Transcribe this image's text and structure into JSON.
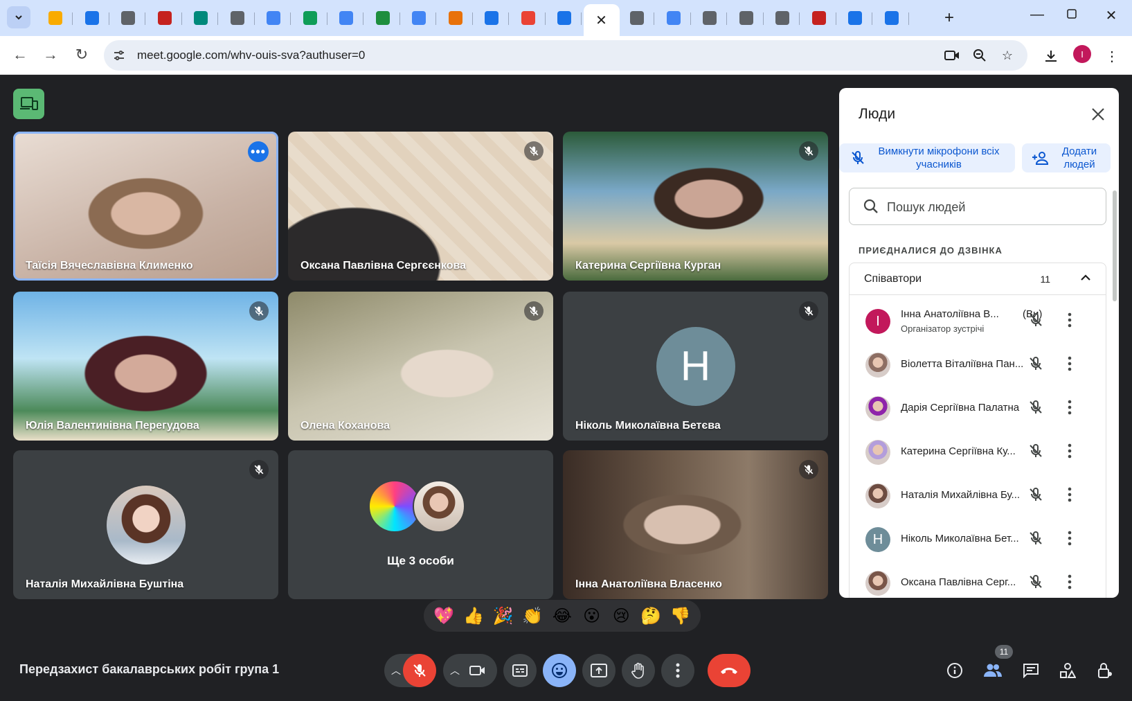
{
  "browser": {
    "tabs": [
      {
        "icon": "chevron-down-icon"
      },
      {
        "icon": "bookmark-ext-icon",
        "color": "#f9ab00"
      },
      {
        "icon": "history-icon",
        "color": "#1a73e8"
      },
      {
        "icon": "chrome-icon",
        "color": "#5f6368"
      },
      {
        "icon": "sound-icon",
        "color": "#c5221f"
      },
      {
        "icon": "puzzle-icon",
        "color": "#00897b"
      },
      {
        "icon": "globe-icon",
        "color": "#5f6368"
      },
      {
        "icon": "docs-icon",
        "color": "#4285f4"
      },
      {
        "icon": "drive-icon",
        "color": "#0f9d58"
      },
      {
        "icon": "docs-icon",
        "color": "#4285f4"
      },
      {
        "icon": "chart-icon",
        "color": "#1e8e3e"
      },
      {
        "icon": "google-icon",
        "color": "#4285f4"
      },
      {
        "icon": "analytics-icon",
        "color": "#e8710a"
      },
      {
        "icon": "analytics-icon",
        "color": "#1a73e8"
      },
      {
        "icon": "gmail-icon",
        "color": "#ea4335"
      },
      {
        "icon": "calendar-icon",
        "color": "#1a73e8"
      },
      {
        "icon": "close-icon",
        "active": true
      },
      {
        "icon": "globe-icon",
        "color": "#5f6368"
      },
      {
        "icon": "google-icon",
        "color": "#4285f4"
      },
      {
        "icon": "globe-icon",
        "color": "#5f6368"
      },
      {
        "icon": "globe-icon",
        "color": "#5f6368"
      },
      {
        "icon": "chrome-icon",
        "color": "#5f6368"
      },
      {
        "icon": "sound-icon",
        "color": "#c5221f"
      },
      {
        "icon": "file-icon",
        "color": "#1a73e8"
      },
      {
        "icon": "file-icon",
        "color": "#1a73e8"
      }
    ],
    "url": "meet.google.com/whv-ouis-sva?authuser=0",
    "profile_initial": "I"
  },
  "meet": {
    "tiles": [
      {
        "name": "Таїсія Вячеславівна Клименко",
        "video": "v1",
        "selected": true,
        "options": true
      },
      {
        "name": "Оксана Павлівна Сергєєнкова",
        "video": "v2",
        "muted": true
      },
      {
        "name": "Катерина Сергіївна Курган",
        "video": "v3",
        "muted": true
      },
      {
        "name": "Юлія Валентинівна Перегудова",
        "video": "v4",
        "muted": true
      },
      {
        "name": "Олена Коханова",
        "video": "v5",
        "muted": true
      },
      {
        "name": "Ніколь Миколаївна Бетєва",
        "avatar_letter": "Н",
        "avatar_color": "#6e8d99",
        "muted": true
      },
      {
        "name": "Наталія Михайлівна Буштіна",
        "avatar_photo": true,
        "muted": true
      },
      {
        "more_people": "Ще 3 особи"
      },
      {
        "name": "Інна Анатоліївна Власенко",
        "video": "v6",
        "muted": true
      }
    ],
    "reactions": [
      "💖",
      "👍",
      "🎉",
      "👏",
      "😂",
      "😮",
      "😢",
      "🤔",
      "👎"
    ],
    "meeting_title": "Передзахист бакалаврських робіт група 1",
    "participant_count": "11"
  },
  "panel": {
    "title": "Люди",
    "mute_all_label": "Вимкнути мікрофони всіх учасників",
    "add_people_label": "Додати людей",
    "search_placeholder": "Пошук людей",
    "section_label": "ПРИЄДНАЛИСЯ ДО ДЗВІНКА",
    "group_label": "Співавтори",
    "group_count": "11",
    "participants": [
      {
        "name": "Інна Анатоліївна В...",
        "suffix": "(Ви)",
        "role": "Організатор зустрічі",
        "initial": "I",
        "color": "#c2185b"
      },
      {
        "name": "Віолетта Віталіївна Пан...",
        "color": "#8d6e63"
      },
      {
        "name": "Дарія Сергіївна Палатна",
        "color": "#8e24aa"
      },
      {
        "name": "Катерина Сергіївна Ку...",
        "color": "#b39ddb"
      },
      {
        "name": "Наталія Михайлівна Бу...",
        "color": "#6d4c41"
      },
      {
        "name": "Ніколь Миколаївна Бет...",
        "initial": "Н",
        "color": "#6e8d99"
      },
      {
        "name": "Оксана Павлівна Серг...",
        "color": "#795548"
      }
    ]
  },
  "colors": {
    "accent": "#8ab4f8",
    "end_call": "#ea4335",
    "mic_off": "#ea4335",
    "active_emoji_btn": "#8ab4f8",
    "people_active": "#8ab4f8"
  }
}
